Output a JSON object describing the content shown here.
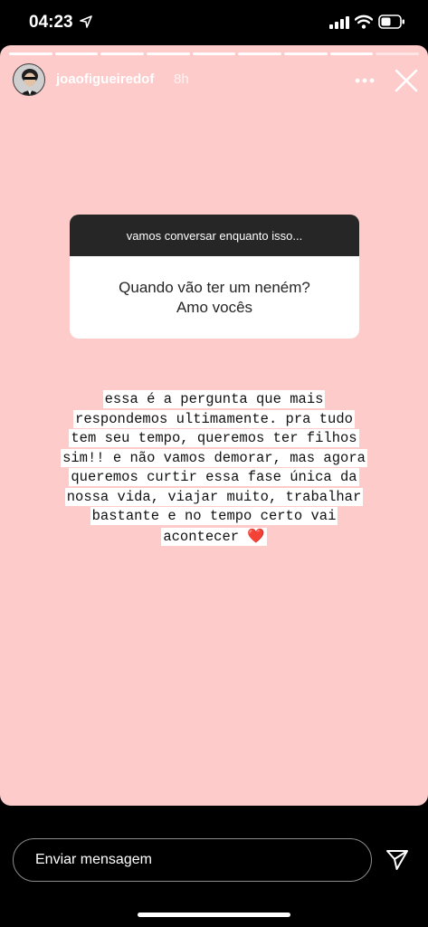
{
  "status": {
    "time": "04:23"
  },
  "story": {
    "username": "joaofigueiredof",
    "time_ago": "8h",
    "progress": {
      "segments": 9,
      "completed": 8
    }
  },
  "question": {
    "header": "vamos conversar enquanto isso...",
    "line1": "Quando vão ter um neném?",
    "line2": "Amo vocês"
  },
  "caption": {
    "lines": [
      "essa é a pergunta que mais",
      "respondemos ultimamente. pra tudo",
      "tem seu tempo, queremos ter filhos",
      "sim!! e não vamos demorar, mas agora",
      "queremos curtir essa fase única da",
      "nossa vida, viajar muito, trabalhar",
      "bastante e no tempo certo vai",
      "acontecer"
    ],
    "emoji": "❤️"
  },
  "reply": {
    "placeholder": "Enviar mensagem"
  },
  "colors": {
    "story_bg": "#fecbcb",
    "sticker_header": "#262626"
  }
}
